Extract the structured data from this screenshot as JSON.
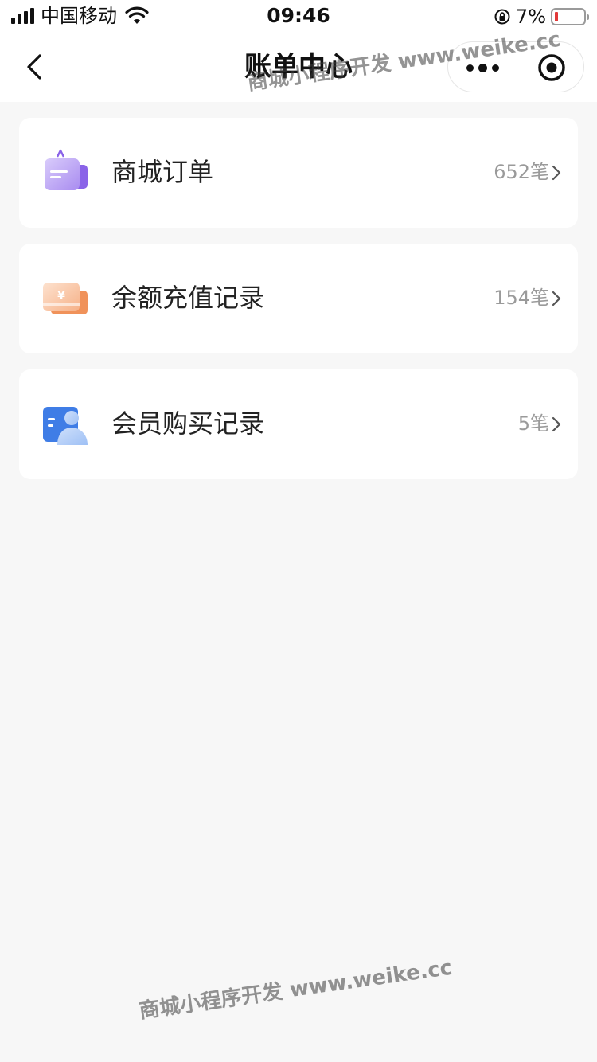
{
  "status_bar": {
    "carrier": "中国移动",
    "time": "09:46",
    "battery_percent": "7%"
  },
  "nav": {
    "title": "账单中心"
  },
  "watermark": {
    "text": "商城小程序开发 www.weike.cc"
  },
  "records": [
    {
      "label": "商城订单",
      "count": "652笔",
      "icon": "shopping-bag-icon",
      "color": "#8a63e8"
    },
    {
      "label": "余额充值记录",
      "count": "154笔",
      "icon": "yen-card-icon",
      "color": "#f0925a"
    },
    {
      "label": "会员购买记录",
      "count": "5笔",
      "icon": "member-card-icon",
      "color": "#3f7de6"
    }
  ],
  "colors": {
    "background": "#f7f7f7",
    "card": "#ffffff",
    "count_text": "#9a9a9a",
    "battery_low": "#e23a3a"
  }
}
